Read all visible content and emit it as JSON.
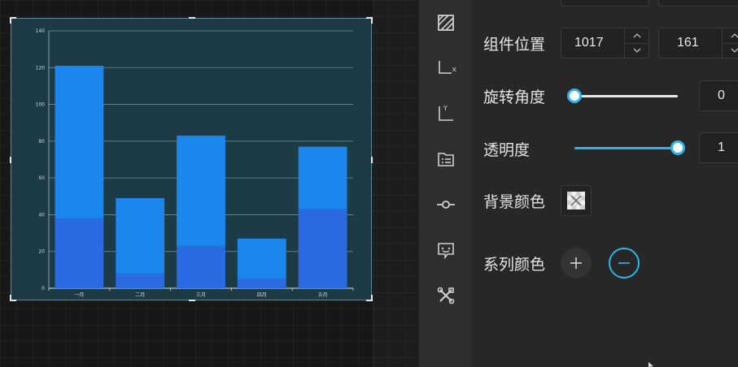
{
  "chart_data": {
    "type": "bar",
    "stacked": true,
    "categories": [
      "一月",
      "二月",
      "三月",
      "四月",
      "五月"
    ],
    "series": [
      {
        "values": [
          38,
          8,
          23,
          5,
          43
        ],
        "color": "#2a6ae2"
      },
      {
        "values": [
          83,
          41,
          60,
          22,
          34
        ],
        "color": "#1a86ee"
      }
    ],
    "ylim": [
      0,
      140
    ],
    "yticks": [
      "0",
      "20",
      "40",
      "60",
      "80",
      "100",
      "120",
      "140"
    ],
    "grid": true,
    "title": "",
    "xlabel": "",
    "ylabel": ""
  },
  "toolbar": {
    "icons": [
      "series-style-icon",
      "x-axis-icon",
      "y-axis-icon",
      "legend-icon",
      "marker-icon",
      "tooltip-icon",
      "tools-icon"
    ],
    "x_axis_sub": "x",
    "y_axis_sub": "Y"
  },
  "props": {
    "position_label": "组件位置",
    "position_x": "1017",
    "position_y": "161",
    "rotation_label": "旋转角度",
    "rotation_value": "0",
    "rotation_fraction": 0,
    "opacity_label": "透明度",
    "opacity_value": "1",
    "opacity_fraction": 1,
    "bg_color_label": "背景颜色",
    "series_color_label": "系列颜色",
    "accent_color": "#2fb4e9"
  }
}
